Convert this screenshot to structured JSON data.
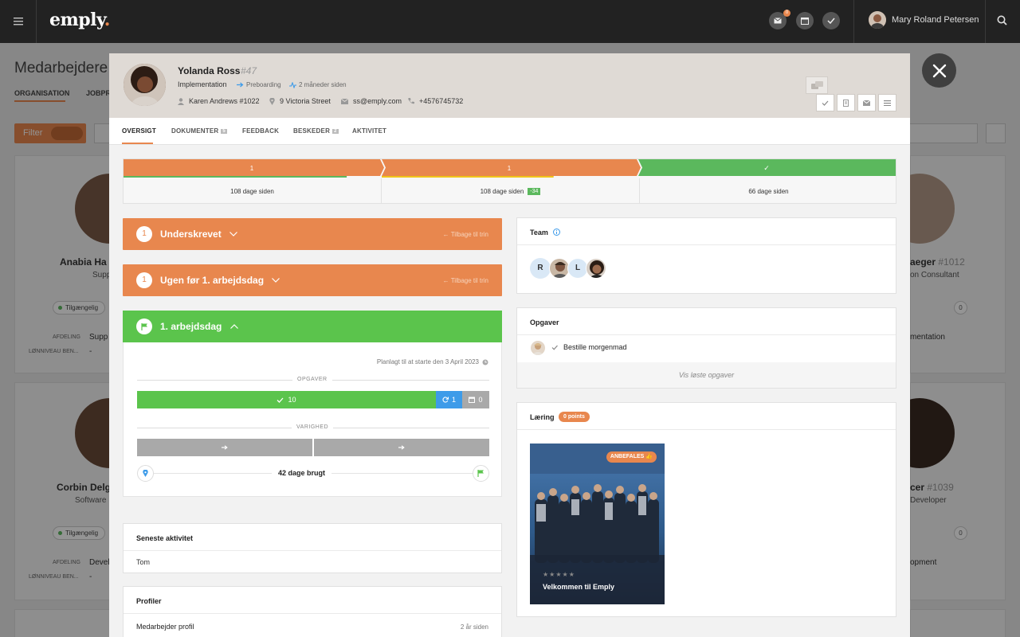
{
  "app": {
    "logo_text": "emply",
    "logo_dot": ".",
    "notification_count": "0",
    "user_name": "Mary Roland Petersen"
  },
  "background": {
    "page_title": "Medarbejdere",
    "tabs": [
      "ORGANISATION",
      "JOBPRO"
    ],
    "filter_label": "Filter",
    "cards": [
      {
        "name": "Anabia Ha",
        "sub": "Supp",
        "status": "Tilgængelig",
        "dept_label": "AFDELING",
        "dept": "Supp",
        "salary_label": "LØNNIVEAU BEN...",
        "salary": "-"
      },
      {
        "name": "Corbin Delg",
        "sub": "Software",
        "status": "Tilgængelig",
        "dept_label": "AFDELING",
        "dept": "Devel",
        "salary_label": "LØNNIVEAU BEN...",
        "salary": "-"
      },
      {
        "name": "aeger",
        "id": "#1012",
        "sub": "on Consultant",
        "dept": "mentation",
        "zero": "0"
      },
      {
        "name": "cer",
        "id": "#1039",
        "sub": "Developer",
        "dept": "opment",
        "zero": "0"
      }
    ]
  },
  "profile": {
    "name": "Yolanda Ross",
    "id": "#47",
    "department": "Implementation",
    "phase": "Preboarding",
    "since": "2 måneder siden",
    "manager": "Karen Andrews #1022",
    "address": "9 Victoria Street",
    "email": "ss@emply.com",
    "phone": "+4576745732"
  },
  "tabs": [
    {
      "label": "OVERSIGT"
    },
    {
      "label": "DOKUMENTER",
      "count": "5"
    },
    {
      "label": "FEEDBACK"
    },
    {
      "label": "BESKEDER",
      "count": "2"
    },
    {
      "label": "AKTIVITET"
    }
  ],
  "progress": {
    "steps": [
      {
        "label": "1",
        "color": "#e8874e",
        "status": "108 dage siden",
        "sub_fill": 0.87,
        "sub_color": "#5bb85d"
      },
      {
        "label": "1",
        "color": "#e8874e",
        "status": "108 dage siden",
        "badge": "-34",
        "sub_fill": 0.67,
        "sub_color": "#f0c419"
      },
      {
        "label": "✓",
        "color": "#5bb85d",
        "status": "66 dage siden"
      }
    ]
  },
  "stages": [
    {
      "num": "1",
      "title": "Underskrevet",
      "back": "Tilbage til trin",
      "color": "#e8874e"
    },
    {
      "num": "1",
      "title": "Ugen før 1. arbejdsdag",
      "back": "Tilbage til trin",
      "color": "#e8874e"
    },
    {
      "title": "1. arbejdsdag",
      "color": "#5bc44c"
    }
  ],
  "current_stage": {
    "planned": "Planlagt til at starte den 3 April 2023",
    "tasks_caption": "OPGAVER",
    "tasks_done": "10",
    "tasks_repeat": "1",
    "tasks_pending": "0",
    "duration_caption": "VARIGHED",
    "days_used": "42 dage brugt"
  },
  "latest_activity": {
    "title": "Seneste aktivitet",
    "value": "Tom"
  },
  "profiles": {
    "title": "Profiler",
    "items": [
      {
        "label": "Medarbejder profil",
        "time": "2 år siden"
      }
    ]
  },
  "team": {
    "title": "Team",
    "members": [
      {
        "initial": "R"
      },
      {
        "initial": ""
      },
      {
        "initial": "L"
      },
      {
        "initial": ""
      }
    ]
  },
  "tasks_panel": {
    "title": "Opgaver",
    "items": [
      {
        "label": "Bestille morgenmad"
      }
    ],
    "show_done": "Vis løste opgaver"
  },
  "learning": {
    "title": "Læring",
    "points": "0 points",
    "course": {
      "badge": "ANBEFALES",
      "title": "Velkommen til Emply",
      "rating": 0
    }
  },
  "colors": {
    "accent": "#e8874e",
    "success": "#5bc44c",
    "info": "#3d9be9"
  }
}
